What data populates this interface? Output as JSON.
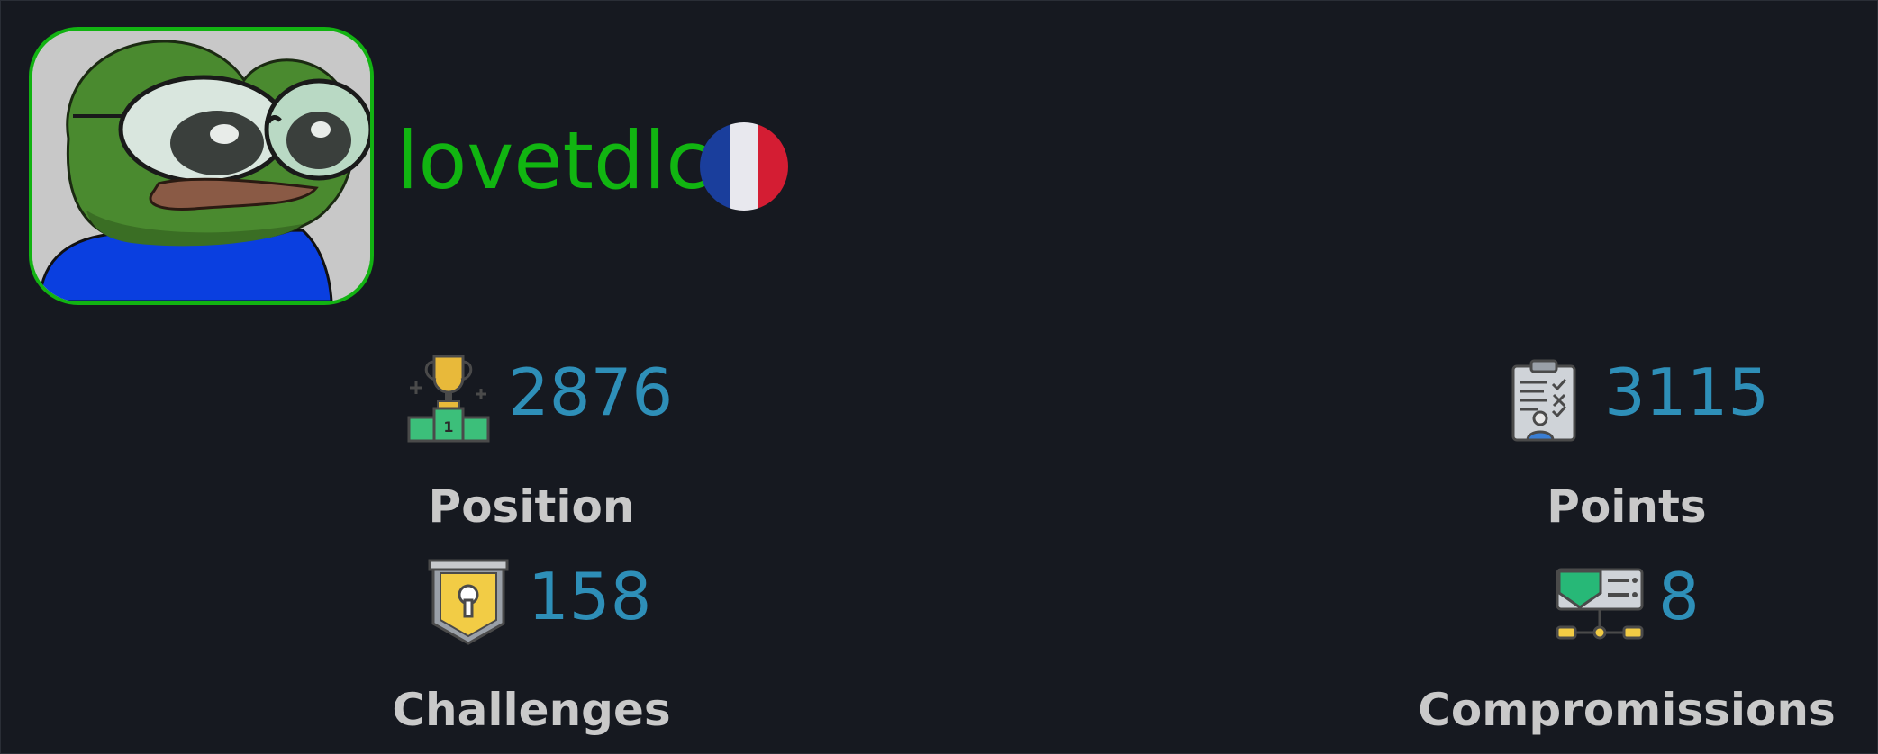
{
  "profile": {
    "username": "lovetdlc",
    "avatar_icon": "pepe-frog-avatar",
    "flag_icon": "france-flag-icon",
    "accent_color": "#11b511"
  },
  "stats": {
    "position": {
      "label": "Position",
      "value": "2876",
      "icon": "podium-trophy-icon"
    },
    "points": {
      "label": "Points",
      "value": "3115",
      "icon": "clipboard-checklist-icon"
    },
    "challenges": {
      "label": "Challenges",
      "value": "158",
      "icon": "shield-keyhole-icon"
    },
    "compromissions": {
      "label": "Compromissions",
      "value": "8",
      "icon": "server-network-icon"
    }
  },
  "colors": {
    "background": "#161920",
    "value": "#2e8fb8",
    "label": "#c9c9c9"
  }
}
